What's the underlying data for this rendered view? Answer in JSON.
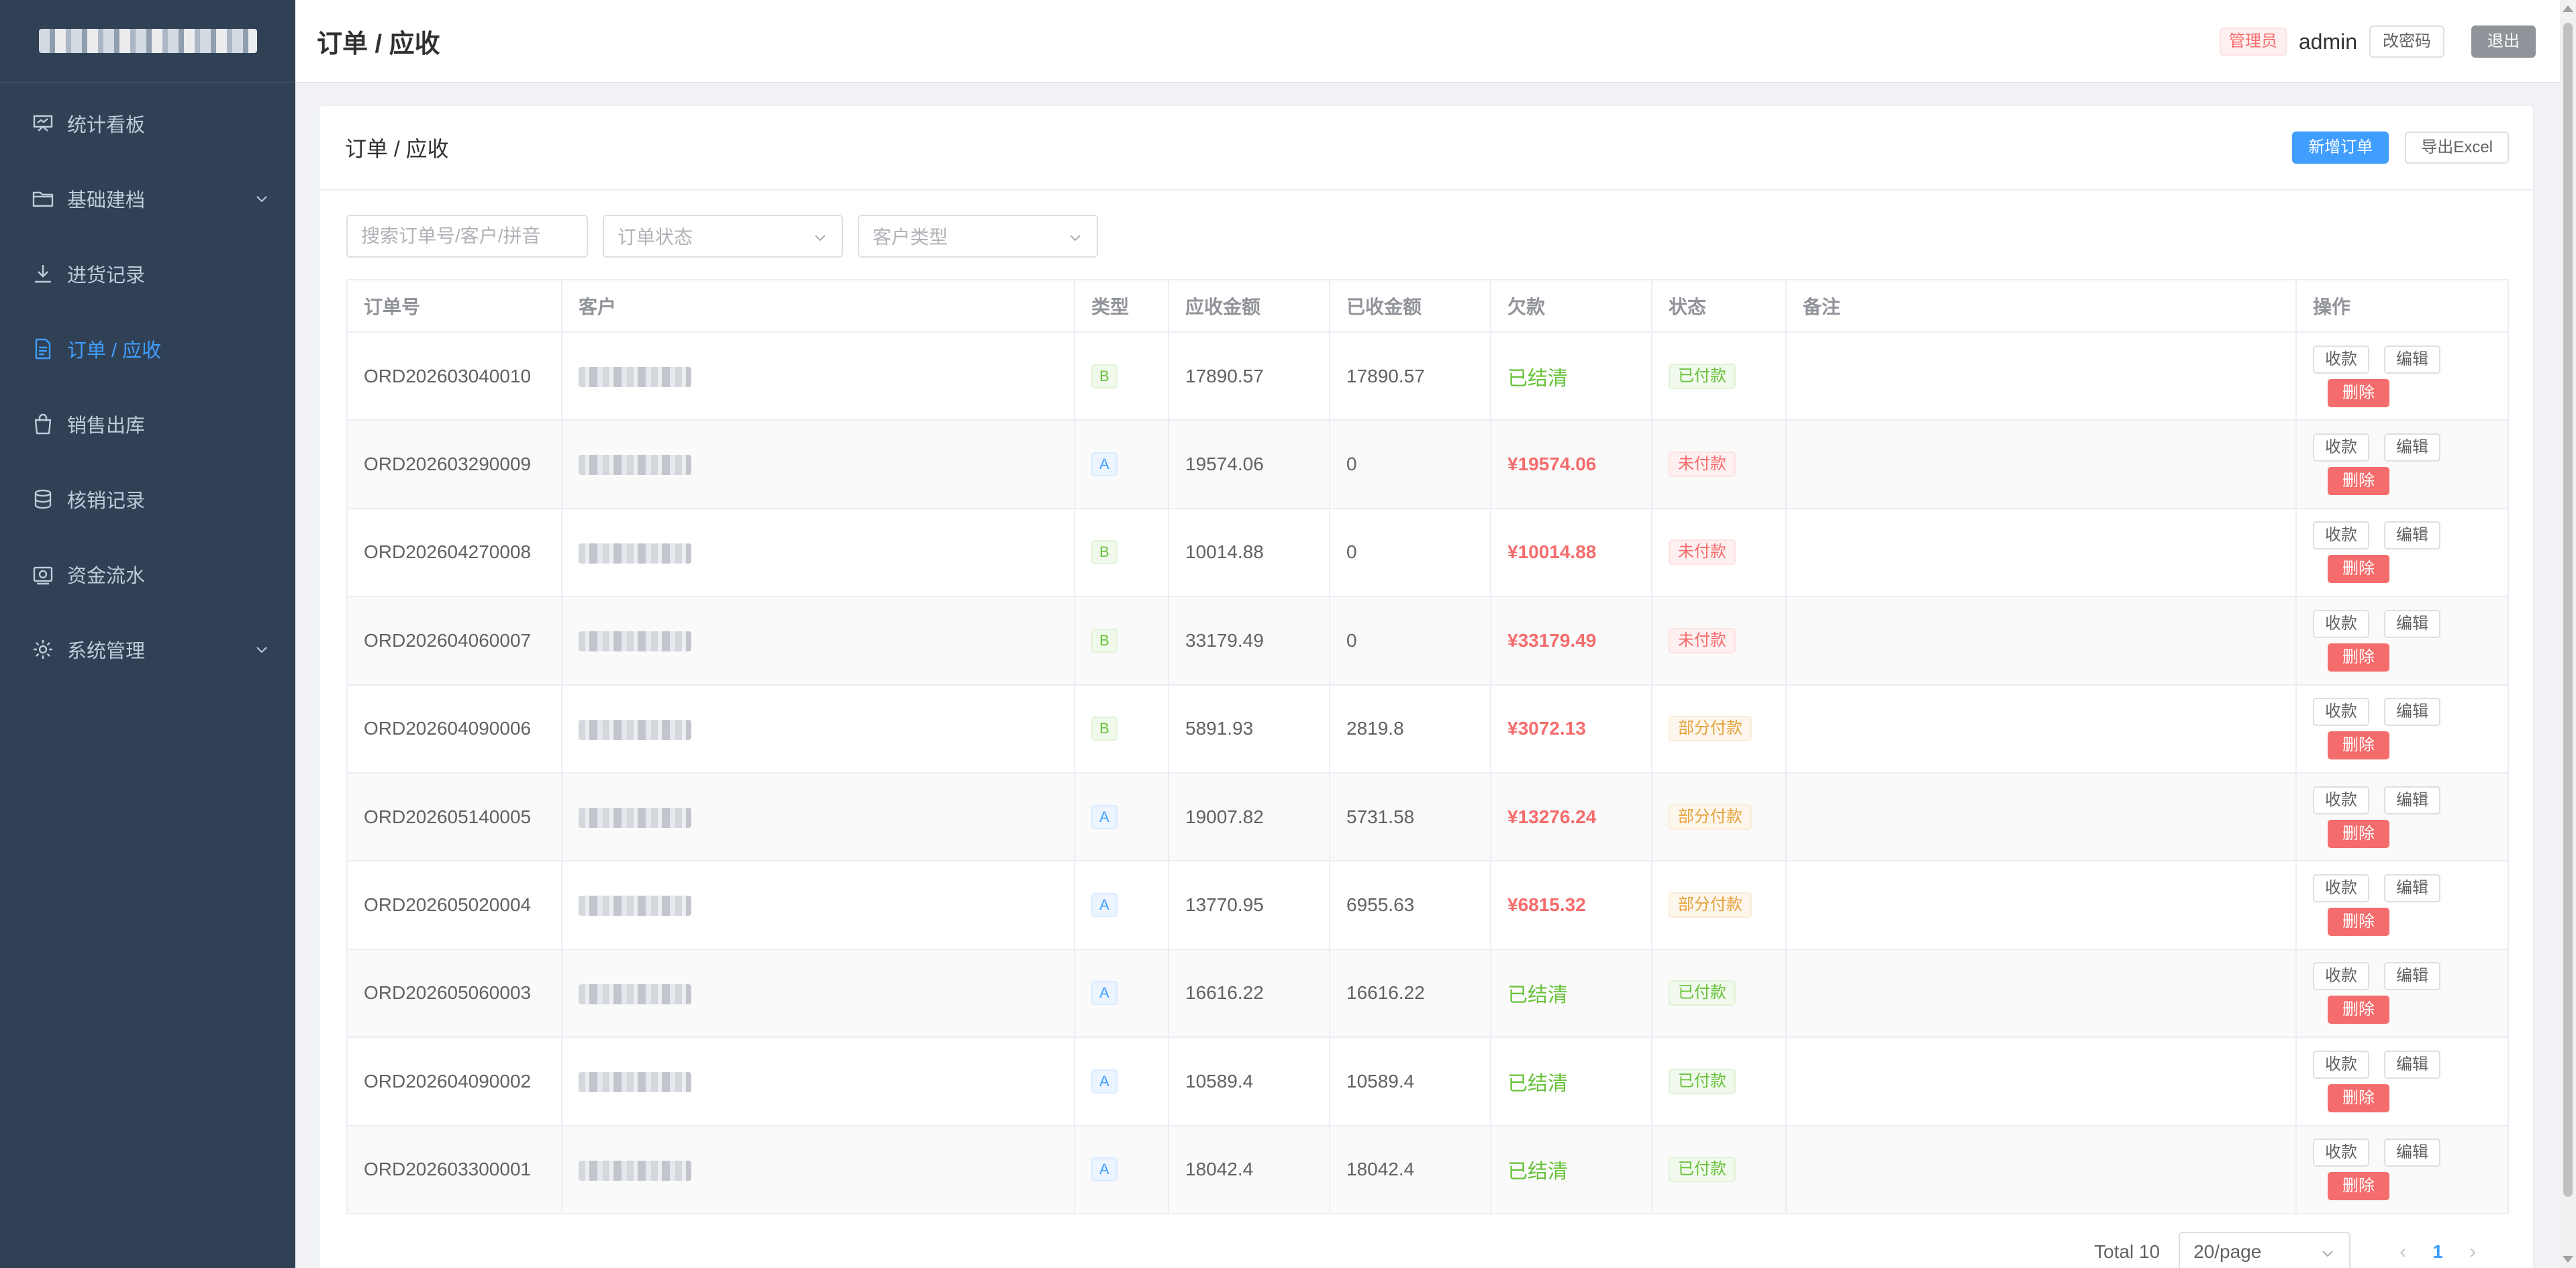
{
  "header": {
    "title": "订单 / 应收",
    "role_badge": "管理员",
    "username": "admin",
    "change_password": "改密码",
    "logout": "退出"
  },
  "sidebar": {
    "items": [
      {
        "label": "统计看板",
        "icon": "dashboard-icon",
        "active": false
      },
      {
        "label": "基础建档",
        "icon": "folder-icon",
        "active": false,
        "expandable": true
      },
      {
        "label": "进货记录",
        "icon": "download-icon",
        "active": false
      },
      {
        "label": "订单 / 应收",
        "icon": "document-icon",
        "active": true
      },
      {
        "label": "销售出库",
        "icon": "shopping-bag-icon",
        "active": false
      },
      {
        "label": "核销记录",
        "icon": "database-icon",
        "active": false
      },
      {
        "label": "资金流水",
        "icon": "money-icon",
        "active": false
      },
      {
        "label": "系统管理",
        "icon": "gear-icon",
        "active": false,
        "expandable": true
      }
    ]
  },
  "card": {
    "title": "订单 / 应收",
    "new_order": "新增订单",
    "export_excel": "导出Excel"
  },
  "filters": {
    "search_placeholder": "搜索订单号/客户/拼音",
    "status_placeholder": "订单状态",
    "customer_type_placeholder": "客户类型"
  },
  "table": {
    "columns": [
      "订单号",
      "客户",
      "类型",
      "应收金额",
      "已收金额",
      "欠款",
      "状态",
      "备注",
      "操作"
    ],
    "rows": [
      {
        "order_no": "ORD202603040010",
        "type": "B",
        "receivable": "17890.57",
        "received": "17890.57",
        "debt": "已结清",
        "status": "已付款"
      },
      {
        "order_no": "ORD202603290009",
        "type": "A",
        "receivable": "19574.06",
        "received": "0",
        "debt": "¥19574.06",
        "status": "未付款"
      },
      {
        "order_no": "ORD202604270008",
        "type": "B",
        "receivable": "10014.88",
        "received": "0",
        "debt": "¥10014.88",
        "status": "未付款"
      },
      {
        "order_no": "ORD202604060007",
        "type": "B",
        "receivable": "33179.49",
        "received": "0",
        "debt": "¥33179.49",
        "status": "未付款"
      },
      {
        "order_no": "ORD202604090006",
        "type": "B",
        "receivable": "5891.93",
        "received": "2819.8",
        "debt": "¥3072.13",
        "status": "部分付款"
      },
      {
        "order_no": "ORD202605140005",
        "type": "A",
        "receivable": "19007.82",
        "received": "5731.58",
        "debt": "¥13276.24",
        "status": "部分付款"
      },
      {
        "order_no": "ORD202605020004",
        "type": "A",
        "receivable": "13770.95",
        "received": "6955.63",
        "debt": "¥6815.32",
        "status": "部分付款"
      },
      {
        "order_no": "ORD202605060003",
        "type": "A",
        "receivable": "16616.22",
        "received": "16616.22",
        "debt": "已结清",
        "status": "已付款"
      },
      {
        "order_no": "ORD202604090002",
        "type": "A",
        "receivable": "10589.4",
        "received": "10589.4",
        "debt": "已结清",
        "status": "已付款"
      },
      {
        "order_no": "ORD202603300001",
        "type": "A",
        "receivable": "18042.4",
        "received": "18042.4",
        "debt": "已结清",
        "status": "已付款"
      }
    ],
    "actions": {
      "collect": "收款",
      "edit": "编辑",
      "delete": "删除"
    }
  },
  "pagination": {
    "total": "Total 10",
    "page_size": "20/page",
    "current_page": "1"
  },
  "colors": {
    "sidebar_bg": "#304156",
    "accent": "#409eff",
    "danger": "#f56c6c",
    "success": "#67c23a",
    "warning": "#e6a23c"
  }
}
